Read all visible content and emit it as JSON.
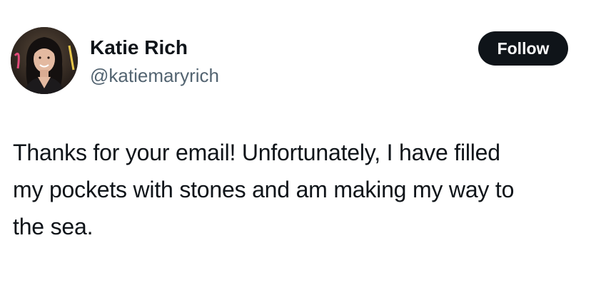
{
  "author": {
    "name": "Katie Rich",
    "handle": "@katiemaryrich",
    "avatar_icon": "profile-photo-avatar"
  },
  "follow_button": {
    "label": "Follow",
    "bg_color": "#0f1419",
    "text_color": "#ffffff"
  },
  "tweet": {
    "lines": [
      "Thanks for your email! Unfortunately, I have filled",
      "my pockets with stones and am making my way to",
      "the sea."
    ]
  },
  "colors": {
    "text_primary": "#0f1419",
    "text_secondary": "#536471",
    "background": "#ffffff"
  }
}
